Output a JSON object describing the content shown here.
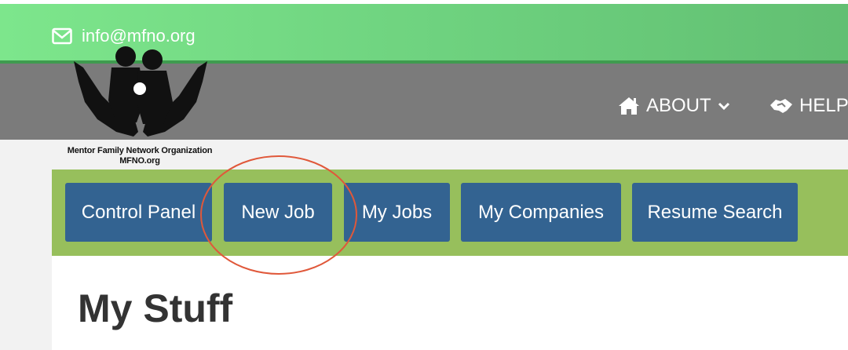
{
  "header": {
    "email": "info@mfno.org",
    "email_icon": "envelope-icon"
  },
  "nav": {
    "items": [
      {
        "label": "ABOUT",
        "icon": "home-icon",
        "dropdown_icon": "chevron-down-icon"
      },
      {
        "label": "HELP",
        "icon": "handshake-icon"
      }
    ]
  },
  "logo": {
    "line1": "Mentor Family Network Organization",
    "line2": "MFNO.org"
  },
  "toolbar": {
    "buttons": [
      {
        "label": "Control Panel"
      },
      {
        "label": "New Job"
      },
      {
        "label": "My Jobs"
      },
      {
        "label": "My Companies"
      },
      {
        "label": "Resume Search"
      }
    ]
  },
  "main": {
    "title": "My Stuff"
  },
  "colors": {
    "top_bar": "#6ccf7d",
    "nav_bar": "#7b7b7b",
    "button_bar": "#97bf5c",
    "button": "#336391",
    "highlight_circle": "#e0583a"
  }
}
